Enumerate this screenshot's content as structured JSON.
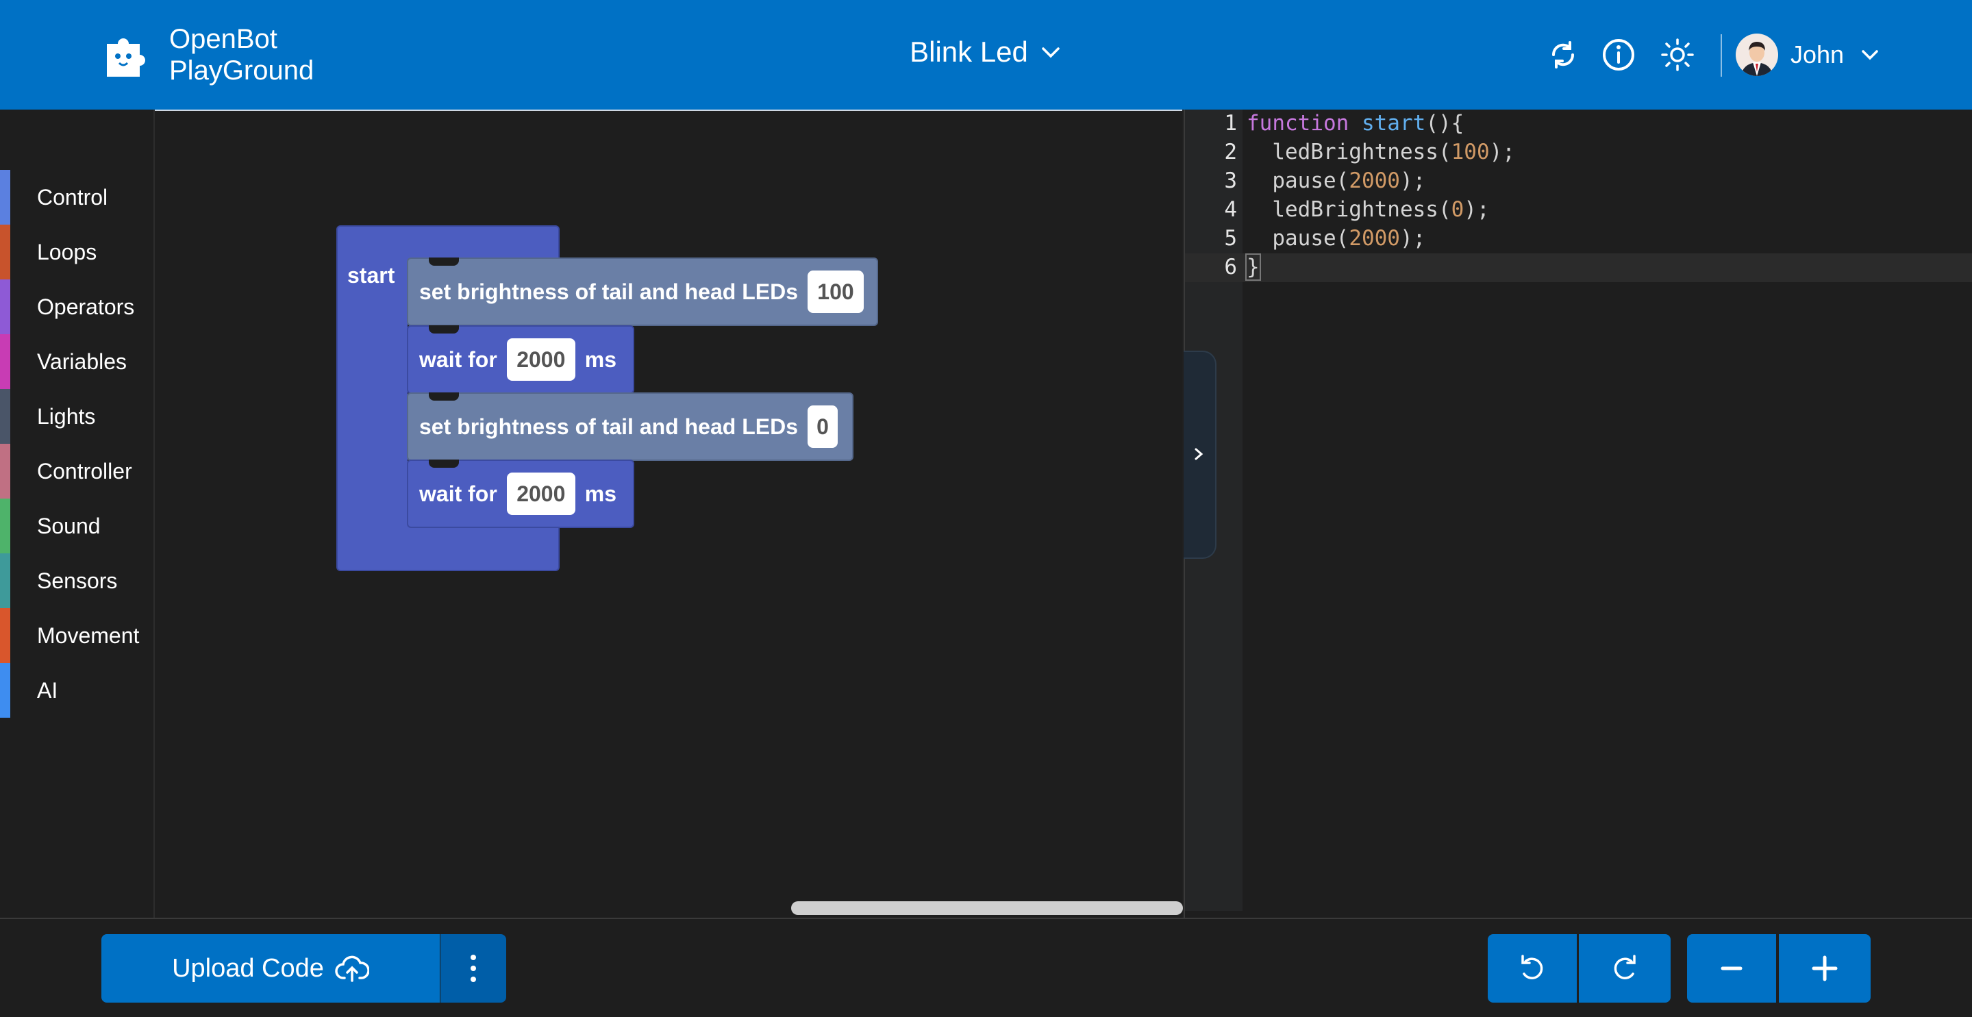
{
  "header": {
    "brand_line1": "OpenBot",
    "brand_line2": "PlayGround",
    "project_name": "Blink Led",
    "user_name": "John",
    "icons": [
      "puzzle-logo-icon",
      "sync-icon",
      "info-icon",
      "sun-icon",
      "chevron-down-icon"
    ]
  },
  "sidebar": {
    "categories": [
      {
        "label": "Control",
        "color": "#5b80e0"
      },
      {
        "label": "Loops",
        "color": "#c8532c"
      },
      {
        "label": "Operators",
        "color": "#8e5ad6"
      },
      {
        "label": "Variables",
        "color": "#c83cb4"
      },
      {
        "label": "Lights",
        "color": "#4a5568"
      },
      {
        "label": "Controller",
        "color": "#c07083"
      },
      {
        "label": "Sound",
        "color": "#4eb36a"
      },
      {
        "label": "Sensors",
        "color": "#3e9a9a"
      },
      {
        "label": "Movement",
        "color": "#d9562c"
      },
      {
        "label": "AI",
        "color": "#3e8df0"
      }
    ]
  },
  "blocks": {
    "start_label": "start",
    "b1_text": "set brightness of tail and head LEDs",
    "b1_value": "100",
    "b2_text": "wait for",
    "b2_value": "2000",
    "b2_unit": "ms",
    "b3_text": "set brightness of tail and head LEDs",
    "b3_value": "0",
    "b4_text": "wait for",
    "b4_value": "2000",
    "b4_unit": "ms"
  },
  "editor": {
    "line_numbers": [
      "1",
      "2",
      "3",
      "4",
      "5",
      "6"
    ],
    "l1_kw": "function",
    "l1_fn": "start",
    "l1_rest": "(){",
    "l2_pre": "  ledBrightness(",
    "l2_num": "100",
    "l2_post": ");",
    "l3_pre": "  pause(",
    "l3_num": "2000",
    "l3_post": ");",
    "l4_pre": "  ledBrightness(",
    "l4_num": "0",
    "l4_post": ");",
    "l5_pre": "  pause(",
    "l5_num": "2000",
    "l5_post": ");",
    "l6": "}"
  },
  "footer": {
    "upload_label": "Upload Code"
  },
  "colors": {
    "brand_blue": "#0071c5",
    "block_blue": "#4c5dc0",
    "block_grey": "#6a7fa6"
  }
}
